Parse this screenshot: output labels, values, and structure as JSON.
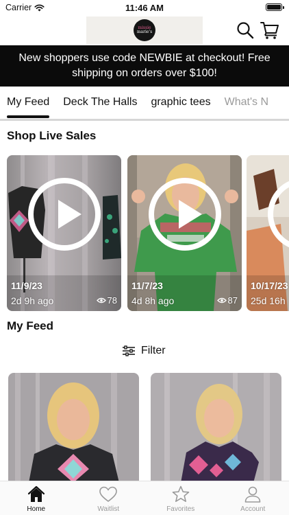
{
  "status_bar": {
    "carrier": "Carrier",
    "time": "11:46 AM",
    "wifi_icon": "wifi-icon",
    "battery_icon": "battery-icon"
  },
  "header": {
    "logo_text_line1": "missie",
    "logo_text_line2": "marie's",
    "search_icon": "search-icon",
    "cart_icon": "cart-icon"
  },
  "promo": {
    "text": "New shoppers use code NEWBIE at checkout! Free shipping on orders over $100!"
  },
  "tabs": [
    {
      "label": "My Feed",
      "active": true
    },
    {
      "label": "Deck The Halls",
      "active": false
    },
    {
      "label": "graphic tees",
      "active": false
    },
    {
      "label": "What's N",
      "active": false
    }
  ],
  "live_sales": {
    "title": "Shop Live Sales",
    "cards": [
      {
        "date": "11/9/23",
        "ago": "2d 9h ago",
        "views": "78"
      },
      {
        "date": "11/7/23",
        "ago": "4d 8h ago",
        "views": "87"
      },
      {
        "date": "10/17/23",
        "ago": "25d 16h"
      }
    ]
  },
  "feed": {
    "title": "My Feed",
    "filter_label": "Filter"
  },
  "tab_bar": {
    "items": [
      {
        "label": "Home",
        "icon": "home-icon",
        "active": true
      },
      {
        "label": "Waitlist",
        "icon": "heart-icon",
        "active": false
      },
      {
        "label": "Favorites",
        "icon": "star-icon",
        "active": false
      },
      {
        "label": "Account",
        "icon": "person-icon",
        "active": false
      }
    ]
  },
  "colors": {
    "banner_bg": "#0b0b0b",
    "text": "#111111",
    "inactive": "#9a9a9a",
    "logo_accent": "#e05c8c"
  }
}
